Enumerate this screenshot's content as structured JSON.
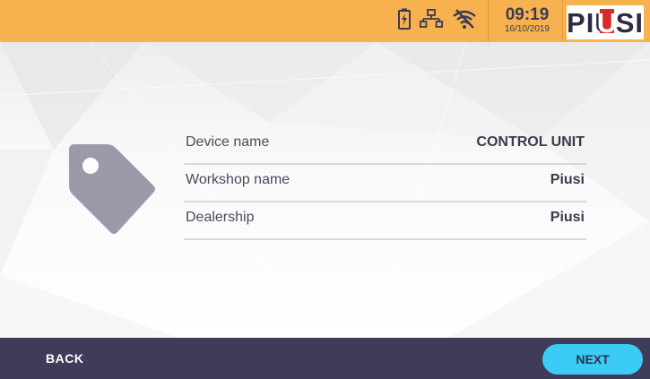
{
  "header": {
    "status_icons": [
      "battery-charging-icon",
      "network-icon",
      "wifi-off-icon"
    ],
    "clock": {
      "time": "09:19",
      "date": "16/10/2019"
    },
    "brand": "PIUSI",
    "brand_colors": {
      "red": "#d92a2a",
      "dark": "#2b2b45"
    }
  },
  "page": {
    "icon": "tag-icon",
    "fields": [
      {
        "label": "Device name",
        "value": "CONTROL UNIT"
      },
      {
        "label": "Workshop name",
        "value": "Piusi"
      },
      {
        "label": "Dealership",
        "value": "Piusi"
      }
    ]
  },
  "footer": {
    "back_label": "BACK",
    "next_label": "NEXT"
  },
  "colors": {
    "header_bg": "#f7b24f",
    "footer_bg": "#3f3c59",
    "accent": "#3ccbf4",
    "icon_grey": "#9c9aa9"
  }
}
